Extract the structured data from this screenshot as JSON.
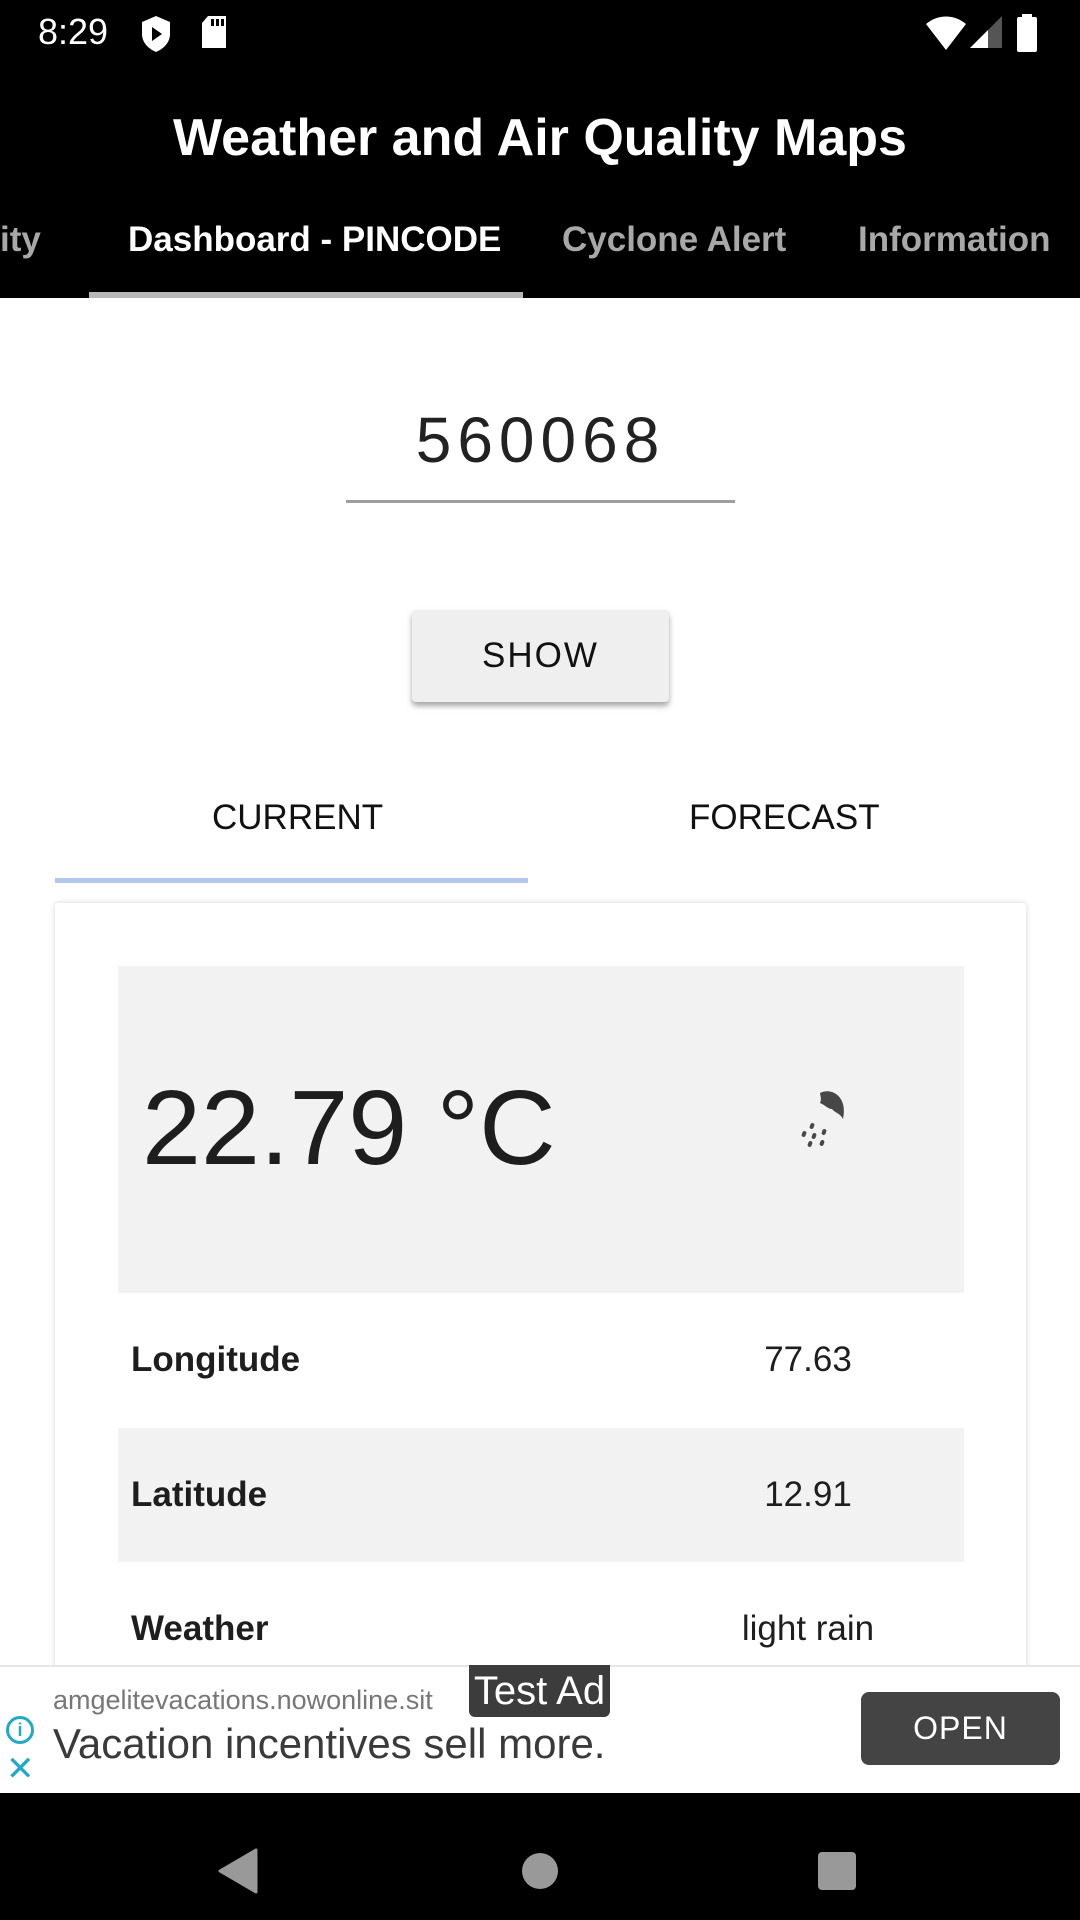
{
  "status_bar": {
    "time": "8:29",
    "left_icons": [
      "play-protect-shield-icon",
      "sd-card-icon"
    ],
    "right_icons": [
      "wifi-icon",
      "cell-signal-icon",
      "battery-icon"
    ]
  },
  "app_bar": {
    "title": "Weather and Air Quality Maps",
    "tabs": [
      {
        "label": "ity",
        "active": false
      },
      {
        "label": "Dashboard - PINCODE",
        "active": true
      },
      {
        "label": "Cyclone Alert",
        "active": false
      },
      {
        "label": "Information",
        "active": false
      }
    ]
  },
  "pincode": {
    "value": "560068",
    "show_button": "SHOW"
  },
  "subtabs": [
    {
      "label": "CURRENT",
      "active": true
    },
    {
      "label": "FORECAST",
      "active": false
    }
  ],
  "current": {
    "temperature": "22.79 °C",
    "weather_icon": "light-rain-icon",
    "rows": [
      {
        "label": "Longitude",
        "value": "77.63"
      },
      {
        "label": "Latitude",
        "value": "12.91"
      },
      {
        "label": "Weather",
        "value": "light rain"
      }
    ]
  },
  "ad": {
    "badge": "Test Ad",
    "url": "amgelitevacations.nowonline.sit",
    "headline": "Vacation incentives sell more.",
    "open_button": "OPEN"
  },
  "colors": {
    "subtab_indicator": "#b3c6ee",
    "ad_accent": "#22a9c8",
    "app_bar": "#000000"
  }
}
